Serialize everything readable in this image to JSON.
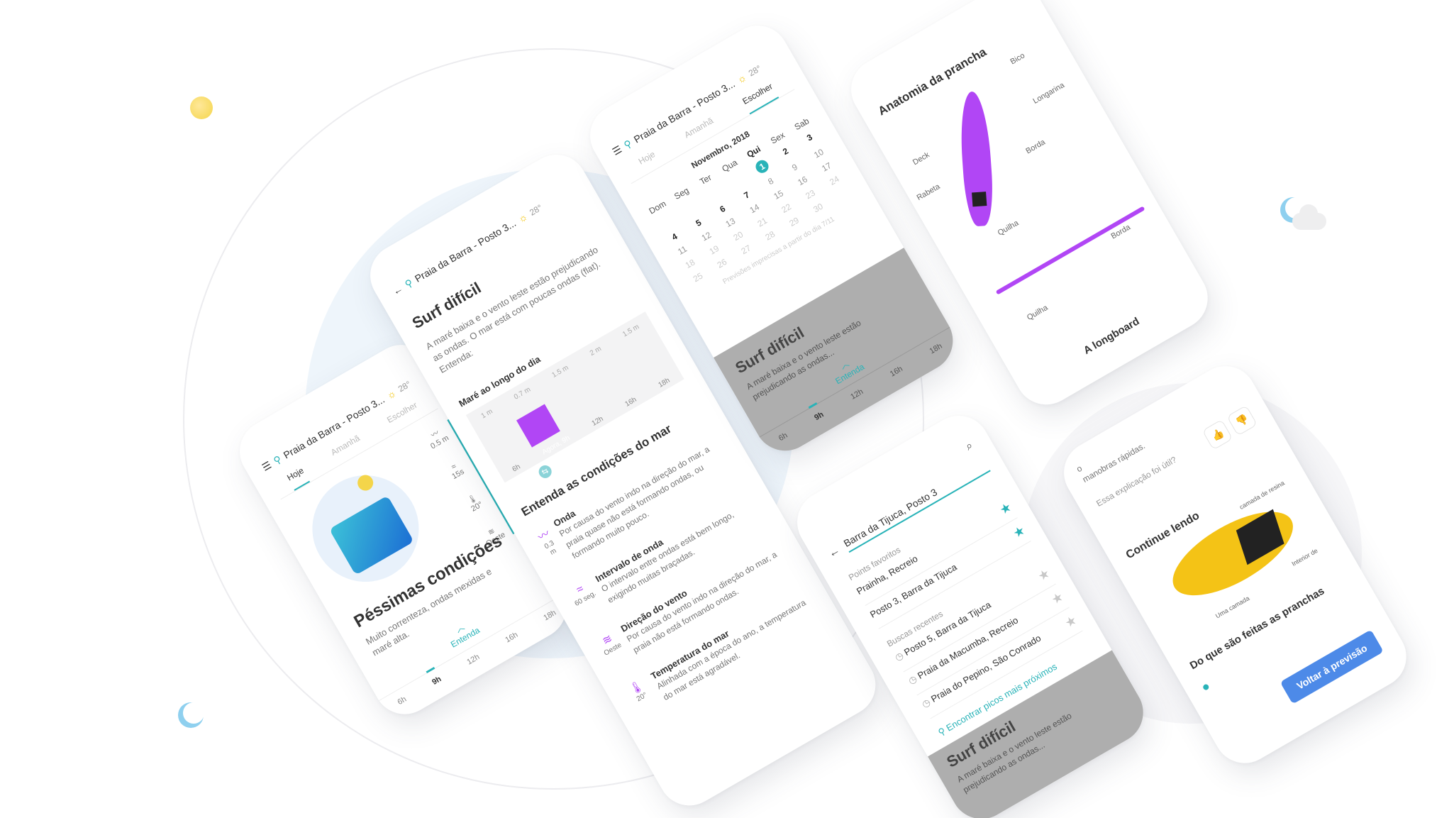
{
  "location": "Praia da Barra - Posto 3...",
  "temperature": "28°",
  "tabs": [
    "Hoje",
    "Amanhã",
    "Escolher"
  ],
  "hours": [
    "6h",
    "9h",
    "12h",
    "16h",
    "18h"
  ],
  "understand": "Entenda",
  "phone1": {
    "title": "Péssimas condições",
    "desc": "Muito correnteza, ondas mexidas e maré alta.",
    "stats": [
      {
        "icon": "wave-icon",
        "value": "0.5 m"
      },
      {
        "icon": "interval-icon",
        "value": "15s"
      },
      {
        "icon": "thermometer-icon",
        "value": "20°"
      },
      {
        "icon": "wind-icon",
        "value": "Oeste"
      }
    ]
  },
  "phone2": {
    "title": "Surf difícil",
    "desc": "A maré baixa e o vento leste estão prejudicando as ondas. O mar está com poucas ondas (flat). Entenda:",
    "tide_title": "Maré ao longo do dia",
    "tide_levels": [
      "1 m",
      "0.7 m",
      "1.5 m",
      "2 m",
      "1.5 m"
    ],
    "tide_hours": [
      "6h",
      "Agora, 9h",
      "12h",
      "16h",
      "18h"
    ],
    "section_title": "Entenda as condições do mar",
    "items": [
      {
        "icon": "wave-icon",
        "value": "0.3 m",
        "title": "Onda",
        "text": "Por causa do vento indo na direção do mar, a praia quase não está formando ondas, ou formando muito pouco."
      },
      {
        "icon": "interval-icon",
        "value": "60 seg.",
        "title": "Intervalo de onda",
        "text": "O intervalo entre ondas está bem longo, exigindo muitas braçadas."
      },
      {
        "icon": "wind-icon",
        "value": "Oeste",
        "title": "Direção do vento",
        "text": "Por causa do vento indo na direção do mar, a praia não está formando ondas."
      },
      {
        "icon": "thermometer-icon",
        "value": "20°",
        "title": "Temperatura do mar",
        "text": "Alinhada com a época do ano, a temperatura do mar está agradável."
      }
    ]
  },
  "phone3": {
    "month": "Novembro, 2018",
    "weekdays": [
      "Dom",
      "Seg",
      "Ter",
      "Qua",
      "Qui",
      "Sex",
      "Sab"
    ],
    "weeks": [
      [
        "",
        "",
        "",
        "",
        "1",
        "2",
        "3"
      ],
      [
        "4",
        "5",
        "6",
        "7",
        "8",
        "9",
        "10"
      ],
      [
        "11",
        "12",
        "13",
        "14",
        "15",
        "16",
        "17"
      ],
      [
        "18",
        "19",
        "20",
        "21",
        "22",
        "23",
        "24"
      ],
      [
        "25",
        "26",
        "27",
        "28",
        "29",
        "30",
        ""
      ]
    ],
    "note": "Previsões imprecisas a partir do dia 7/11",
    "panel_title": "Surf difícil",
    "panel_desc": "A maré baixa e o vento leste estão prejudicando as ondas..."
  },
  "phone4": {
    "title": "Anatomia da prancha",
    "labels": [
      "Bico",
      "Longarina",
      "Deck",
      "Rabeta",
      "Borda",
      "Quilha",
      "Borda",
      "Quilha"
    ],
    "subtitle": "A longboard"
  },
  "phone5": {
    "search_value": "Barra da Tijuca, Posto 3",
    "favorites_label": "Points favoritos",
    "favorites": [
      "Prainha, Recreio",
      "Posto 3, Barra da Tijuca"
    ],
    "recent_label": "Buscas recentes",
    "recent": [
      "Posto 5, Barra da Tijuca",
      "Praia da Macumba, Recreio",
      "Praia do Pepino, São Conrado"
    ],
    "find_nearby": "Encontrar picos mais próximos",
    "panel_title": "Surf difícil",
    "panel_desc": "A maré baixa e o vento leste estão prejudicando as ondas..."
  },
  "phone6": {
    "top_text_1": "o",
    "top_text_2": "manobras rápidas.",
    "useful": "Essa explicação foi útil?",
    "continue": "Continue lendo",
    "labels": [
      "camada de resina",
      "Interior de",
      "Uma camada"
    ],
    "subtitle": "Do que são feitas as pranchas",
    "back_button": "Voltar à previsão"
  },
  "colors": {
    "teal": "#29b3b8",
    "purple": "#b146f5",
    "blue_button": "#4d8ae8",
    "yellow": "#f4c316"
  }
}
